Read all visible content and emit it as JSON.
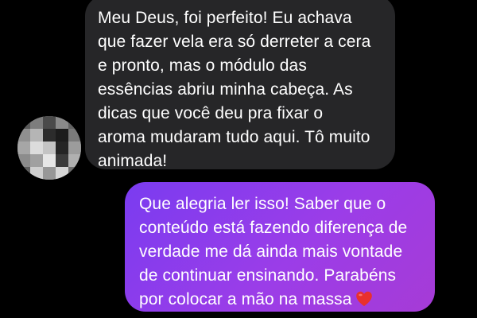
{
  "colors": {
    "background": "#000000",
    "received_bubble": "#262628",
    "sent_bubble_start": "#7a3cf0",
    "sent_bubble_end": "#a63bd6",
    "text": "#ffffff",
    "heart": "#e8302e"
  },
  "conversation": {
    "received": {
      "avatar_icon": "pixelated-avatar",
      "lines": [
        "Meu Deus, foi perfeito! Eu achava",
        "que fazer vela era só derreter a cera",
        "e pronto, mas o módulo das",
        "essências abriu minha cabeça. As",
        "dicas que você deu pra fixar o",
        "aroma mudaram tudo aqui. Tô muito",
        "animada!"
      ]
    },
    "sent": {
      "lines": [
        "Que alegria ler isso! Saber que o",
        "conteúdo está fazendo diferença de",
        "verdade me dá ainda mais vontade",
        "de continuar ensinando. Parabéns",
        "por colocar a mão na massa"
      ],
      "emoji": "red-heart-icon"
    }
  }
}
